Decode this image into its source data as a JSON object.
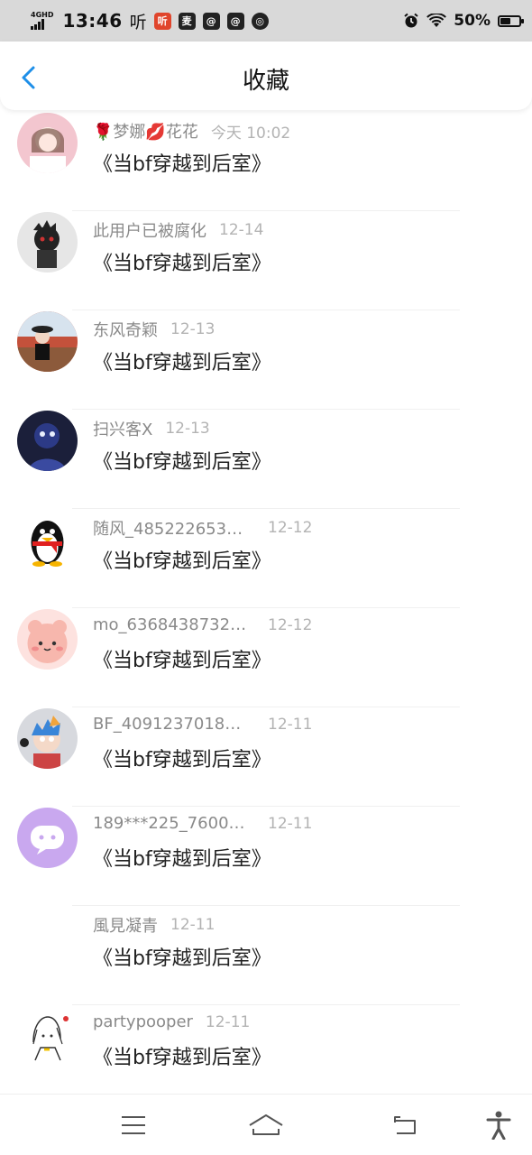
{
  "status_bar": {
    "network": "4GHD",
    "time": "13:46",
    "apps": [
      "听",
      "听",
      "麦",
      "@",
      "@",
      "◎"
    ],
    "battery": "50%"
  },
  "header": {
    "title": "收藏"
  },
  "favorites": [
    {
      "name": "🌹梦娜💋花花",
      "time": "今天 10:02",
      "text": "《当bf穿越到后室》"
    },
    {
      "name": "此用户已被腐化",
      "time": "12-14",
      "text": "《当bf穿越到后室》"
    },
    {
      "name": "东风奇颖",
      "time": "12-13",
      "text": "《当bf穿越到后室》"
    },
    {
      "name": "扫兴客X",
      "time": "12-13",
      "text": "《当bf穿越到后室》"
    },
    {
      "name": "随风_485222653…",
      "time": "12-12",
      "text": "《当bf穿越到后室》"
    },
    {
      "name": "mo_6368438732…",
      "time": "12-12",
      "text": "《当bf穿越到后室》"
    },
    {
      "name": "BF_4091237018…",
      "time": "12-11",
      "text": "《当bf穿越到后室》"
    },
    {
      "name": "189***225_7600…",
      "time": "12-11",
      "text": "《当bf穿越到后室》"
    },
    {
      "name": "風見凝青",
      "time": "12-11",
      "text": "《当bf穿越到后室》"
    },
    {
      "name": "partypooper",
      "time": "12-11",
      "text": "《当bf穿越到后室》"
    }
  ],
  "colors": {
    "accent": "#1e8fe8",
    "name": "#8a8a8a",
    "time": "#b3b3b3",
    "status_bar_bg": "#d9d9d9"
  }
}
